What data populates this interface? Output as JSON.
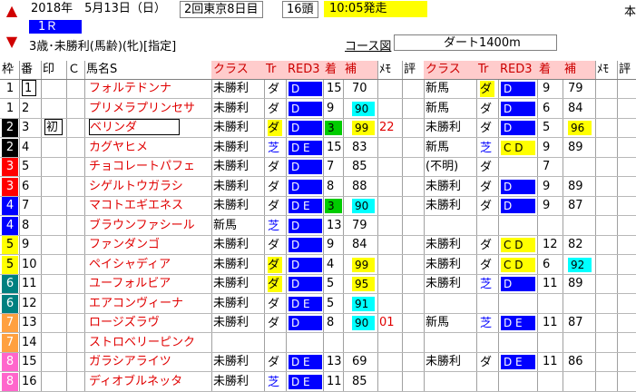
{
  "header": {
    "date": "2018年　5月13日（日）",
    "meeting": "2回東京8日目",
    "heads": "16頭",
    "start": "10:05発走",
    "corner": "本",
    "race": "1Ｒ",
    "conditions": "3歳･未勝利(馬齢)(牝)[指定]",
    "course_label": "コース図",
    "course": "ダート1400m",
    "up_arrow": "▲",
    "down_arrow": "▼"
  },
  "columns": [
    "枠",
    "番",
    "印",
    "Ｃ",
    "馬名S",
    "クラス",
    "Tr",
    "RED3",
    "着",
    "補",
    "ﾒﾓ",
    "評",
    "クラス",
    "Tr",
    "RED3",
    "着",
    "補",
    "ﾒﾓ",
    "評"
  ],
  "rows": [
    {
      "waku": "1",
      "wk": "w1",
      "num": "1",
      "mark": "",
      "c": "",
      "name": "フォルテドンナ",
      "cls": "未勝利",
      "tr": "ダ",
      "trc": "",
      "red": "D",
      "redc": "tb",
      "pos": "15",
      "hosei": "70",
      "hc": "",
      "memo": "",
      "cls2": "新馬",
      "tr2": "ダ",
      "tr2c": "sy",
      "red2": "D",
      "red2c": "tb",
      "pos2": "9",
      "hosei2": "79",
      "h2c": ""
    },
    {
      "waku": "1",
      "wk": "w1",
      "num": "2",
      "mark": "",
      "c": "",
      "name": "プリメラプリンセサ",
      "cls": "未勝利",
      "tr": "ダ",
      "trc": "",
      "red": "D",
      "redc": "tb",
      "pos": "9",
      "hosei": "90",
      "hc": "tc",
      "memo": "",
      "cls2": "新馬",
      "tr2": "ダ",
      "tr2c": "",
      "red2": "D",
      "red2c": "tb",
      "pos2": "6",
      "hosei2": "84",
      "h2c": ""
    },
    {
      "waku": "2",
      "wk": "w2",
      "num": "3",
      "mark": "初",
      "c": "",
      "name": "ベリンダ",
      "cls": "未勝利",
      "tr": "ダ",
      "trc": "sy",
      "red": "D",
      "redc": "tb",
      "pos": "3",
      "posc": "tg",
      "hosei": "99",
      "hc": "ty",
      "memo": "22",
      "cls2": "未勝利",
      "tr2": "ダ",
      "tr2c": "",
      "red2": "D",
      "red2c": "tb",
      "pos2": "5",
      "hosei2": "96",
      "h2c": "ty"
    },
    {
      "waku": "2",
      "wk": "w2",
      "num": "4",
      "mark": "",
      "c": "",
      "name": "カグヤヒメ",
      "cls": "未勝利",
      "tr": "芝",
      "trc": "sb",
      "red": "D E",
      "redc": "tb",
      "pos": "15",
      "hosei": "83",
      "hc": "",
      "memo": "",
      "cls2": "新馬",
      "tr2": "芝",
      "tr2c": "sb",
      "red2": "C D",
      "red2c": "ty",
      "pos2": "9",
      "hosei2": "89",
      "h2c": ""
    },
    {
      "waku": "3",
      "wk": "w3",
      "num": "5",
      "mark": "",
      "c": "",
      "name": "チョコレートパフェ",
      "cls": "未勝利",
      "tr": "ダ",
      "trc": "",
      "red": "D",
      "redc": "tb",
      "pos": "7",
      "hosei": "85",
      "hc": "",
      "memo": "",
      "cls2": "(不明)",
      "tr2": "ダ",
      "tr2c": "",
      "red2": "",
      "red2c": "",
      "pos2": "7",
      "hosei2": "",
      "h2c": ""
    },
    {
      "waku": "3",
      "wk": "w3",
      "num": "6",
      "mark": "",
      "c": "",
      "name": "シゲルトウガラシ",
      "cls": "未勝利",
      "tr": "ダ",
      "trc": "",
      "red": "D",
      "redc": "tb",
      "pos": "8",
      "hosei": "88",
      "hc": "",
      "memo": "",
      "cls2": "未勝利",
      "tr2": "ダ",
      "tr2c": "",
      "red2": "D",
      "red2c": "tb",
      "pos2": "9",
      "hosei2": "89",
      "h2c": ""
    },
    {
      "waku": "4",
      "wk": "w4",
      "num": "7",
      "mark": "",
      "c": "",
      "name": "マコトエギエネス",
      "cls": "未勝利",
      "tr": "ダ",
      "trc": "",
      "red": "D E",
      "redc": "tb",
      "pos": "3",
      "posc": "tg",
      "hosei": "90",
      "hc": "tc",
      "memo": "",
      "cls2": "未勝利",
      "tr2": "ダ",
      "tr2c": "",
      "red2": "D",
      "red2c": "tb",
      "pos2": "9",
      "hosei2": "87",
      "h2c": ""
    },
    {
      "waku": "4",
      "wk": "w4",
      "num": "8",
      "mark": "",
      "c": "",
      "name": "ブラウンファシール",
      "cls": "新馬",
      "tr": "芝",
      "trc": "sb",
      "red": "D",
      "redc": "tb",
      "pos": "13",
      "hosei": "79",
      "hc": "",
      "memo": "",
      "cls2": "",
      "tr2": "",
      "tr2c": "",
      "red2": "",
      "red2c": "",
      "pos2": "",
      "hosei2": "",
      "h2c": ""
    },
    {
      "waku": "5",
      "wk": "w5",
      "num": "9",
      "mark": "",
      "c": "",
      "name": "ファンダンゴ",
      "cls": "未勝利",
      "tr": "ダ",
      "trc": "",
      "red": "D",
      "redc": "tb",
      "pos": "9",
      "hosei": "84",
      "hc": "",
      "memo": "",
      "cls2": "未勝利",
      "tr2": "ダ",
      "tr2c": "",
      "red2": "C D",
      "red2c": "ty",
      "pos2": "12",
      "hosei2": "82",
      "h2c": ""
    },
    {
      "waku": "5",
      "wk": "w5",
      "num": "10",
      "mark": "",
      "c": "",
      "name": "ペイシャディア",
      "cls": "未勝利",
      "tr": "ダ",
      "trc": "sy",
      "red": "D",
      "redc": "tb",
      "pos": "4",
      "hosei": "99",
      "hc": "ty",
      "memo": "",
      "cls2": "未勝利",
      "tr2": "ダ",
      "tr2c": "",
      "red2": "C D",
      "red2c": "ty",
      "pos2": "6",
      "hosei2": "92",
      "h2c": "tc"
    },
    {
      "waku": "6",
      "wk": "w6",
      "num": "11",
      "mark": "",
      "c": "",
      "name": "ユーフォルビア",
      "cls": "未勝利",
      "tr": "ダ",
      "trc": "sy",
      "red": "D",
      "redc": "tb",
      "pos": "5",
      "hosei": "95",
      "hc": "ty",
      "memo": "",
      "cls2": "未勝利",
      "tr2": "芝",
      "tr2c": "sb",
      "red2": "D",
      "red2c": "tb",
      "pos2": "11",
      "hosei2": "89",
      "h2c": ""
    },
    {
      "waku": "6",
      "wk": "w6",
      "num": "12",
      "mark": "",
      "c": "",
      "name": "エアコンヴィーナ",
      "cls": "未勝利",
      "tr": "ダ",
      "trc": "",
      "red": "D E",
      "redc": "tb",
      "pos": "5",
      "hosei": "91",
      "hc": "tc",
      "memo": "",
      "cls2": "",
      "tr2": "",
      "tr2c": "",
      "red2": "",
      "red2c": "",
      "pos2": "",
      "hosei2": "",
      "h2c": ""
    },
    {
      "waku": "7",
      "wk": "w7",
      "num": "13",
      "mark": "",
      "c": "",
      "name": "ロージズラヴ",
      "cls": "未勝利",
      "tr": "ダ",
      "trc": "",
      "red": "D",
      "redc": "tb",
      "pos": "8",
      "hosei": "90",
      "hc": "tc",
      "memo": "01",
      "cls2": "新馬",
      "tr2": "芝",
      "tr2c": "sb",
      "red2": "D E",
      "red2c": "tb",
      "pos2": "11",
      "hosei2": "87",
      "h2c": ""
    },
    {
      "waku": "7",
      "wk": "w7",
      "num": "14",
      "mark": "",
      "c": "",
      "name": "ストロベリーピンク",
      "cls": "",
      "tr": "",
      "trc": "",
      "red": "",
      "redc": "",
      "pos": "",
      "hosei": "",
      "hc": "",
      "memo": "",
      "cls2": "",
      "tr2": "",
      "tr2c": "",
      "red2": "",
      "red2c": "",
      "pos2": "",
      "hosei2": "",
      "h2c": ""
    },
    {
      "waku": "8",
      "wk": "w8",
      "num": "15",
      "mark": "",
      "c": "",
      "name": "ガラシアライツ",
      "cls": "未勝利",
      "tr": "ダ",
      "trc": "",
      "red": "D E",
      "redc": "tb",
      "pos": "13",
      "hosei": "69",
      "hc": "",
      "memo": "",
      "cls2": "未勝利",
      "tr2": "ダ",
      "tr2c": "",
      "red2": "D E",
      "red2c": "tb",
      "pos2": "11",
      "hosei2": "86",
      "h2c": ""
    },
    {
      "waku": "8",
      "wk": "w8",
      "num": "16",
      "mark": "",
      "c": "",
      "name": "ディオブルネッタ",
      "cls": "未勝利",
      "tr": "芝",
      "trc": "sb",
      "red": "D E",
      "redc": "tb",
      "pos": "11",
      "hosei": "85",
      "hc": "",
      "memo": "",
      "cls2": "",
      "tr2": "",
      "tr2c": "",
      "red2": "",
      "red2c": "",
      "pos2": "",
      "hosei2": "",
      "h2c": ""
    }
  ]
}
